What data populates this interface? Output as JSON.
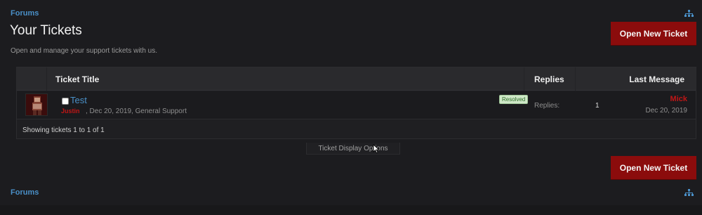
{
  "breadcrumb": {
    "top": "Forums",
    "bottom": "Forums"
  },
  "page": {
    "title": "Your Tickets",
    "description": "Open and manage your support tickets with us."
  },
  "actions": {
    "open_new_ticket": "Open New Ticket"
  },
  "table": {
    "headers": {
      "title": "Ticket Title",
      "replies": "Replies",
      "last_message": "Last Message"
    },
    "rows": [
      {
        "title": "Test",
        "author": "Justin",
        "meta": ", Dec 20, 2019, General Support",
        "status": "Resolved",
        "replies_label": "Replies:",
        "replies_count": "1",
        "last_user": "Mick",
        "last_date": "Dec 20, 2019"
      }
    ],
    "showing": "Showing tickets 1 to 1 of 1"
  },
  "display_options": "Ticket Display Options",
  "colors": {
    "background": "#1c1c1f",
    "accent_red": "#8b0c0c",
    "link_blue": "#4a90c8",
    "username_red": "#c01616",
    "resolved_bg": "#cfe8c8"
  },
  "icons": {
    "sitemap": "sitemap-icon",
    "cursor": "mouse-cursor-icon"
  }
}
